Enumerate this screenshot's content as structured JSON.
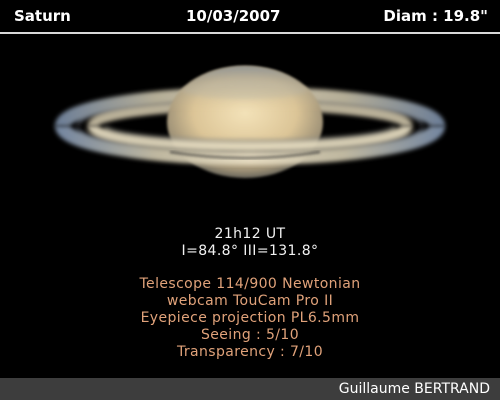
{
  "header": {
    "object": "Saturn",
    "date": "10/03/2007",
    "diameter": "Diam : 19.8\""
  },
  "observation": {
    "time": "21h12 UT",
    "longitudes": "I=84.8° III=131.8°"
  },
  "equipment": [
    "Telescope 114/900 Newtonian",
    "webcam TouCam Pro II",
    "Eyepiece projection PL6.5mm",
    "Seeing : 5/10",
    "Transparency : 7/10"
  ],
  "footer": {
    "credit": "Guillaume BERTRAND"
  },
  "colors": {
    "background": "#000000",
    "header_text": "#ffffff",
    "time_text": "#f2f2f2",
    "details_text": "#e0a27a",
    "footer_bar": "#3d3d3d"
  }
}
